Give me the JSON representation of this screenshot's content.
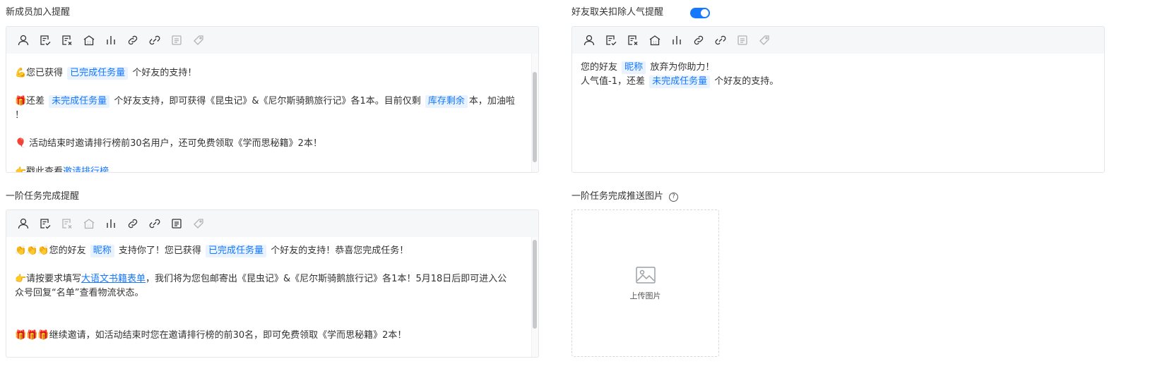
{
  "sections": {
    "new_member": {
      "title": "新成员加入提醒"
    },
    "unfollow": {
      "title": "好友取关扣除人气提醒",
      "toggle_on": true
    },
    "stage_complete": {
      "title": "一阶任务完成提醒"
    },
    "stage_image": {
      "title": "一阶任务完成推送图片",
      "help_icon": "?"
    }
  },
  "toolbar_icons": [
    "user-icon",
    "checklist-icon",
    "remove-list-icon",
    "shop-icon",
    "bar-chart-icon",
    "link-icon",
    "unlink-icon",
    "article-icon",
    "tag-icon"
  ],
  "editor1": {
    "line1": {
      "emoji": "💪",
      "pre": "您已获得",
      "tag": "已完成任务量",
      "post": "个好友的支持！"
    },
    "line2": {
      "emoji": "🎁",
      "pre": "还差",
      "tag1": "未完成任务量",
      "mid": "个好友支持，即可获得《昆虫记》&《尼尔斯骑鹅旅行记》各1本。目前仅剩",
      "tag2": "库存剩余",
      "post": "本，加油啦",
      "wrap": "！"
    },
    "line3": {
      "emoji": "🎈",
      "text": "活动结束时邀请排行榜前30名用户，还可免费领取《学而思秘籍》2本！"
    },
    "line4": {
      "emoji": "👉",
      "pre": "戳此查看",
      "link": "邀请排行榜"
    }
  },
  "editor2": {
    "line1": {
      "pre": "您的好友",
      "tag": "昵称",
      "post": "放弃为你助力！"
    },
    "line2": {
      "pre": "人气值-1，还差",
      "tag": "未完成任务量",
      "post": "个好友的支持。"
    }
  },
  "editor3": {
    "line1": {
      "emoji": "👏👏👏",
      "pre": "您的好友",
      "tag1": "昵称",
      "mid": "支持你了！您已获得",
      "tag2": "已完成任务量",
      "post": "个好友的支持！恭喜您完成任务！"
    },
    "line2": {
      "emoji": "👉",
      "pre": "请按要求填写",
      "link": "大语文书籍表单",
      "post": "，我们将为您包邮寄出《昆虫记》&《尼尔斯骑鹅旅行记》各1本！5月18日后即可进入公",
      "wrap": "众号回复“名单”查看物流状态。"
    },
    "line3": {
      "emoji": "🎁🎁🎁",
      "text": "继续邀请，如活动结束时您在邀请排行榜的前30名，即可免费领取《学而思秘籍》2本！"
    }
  },
  "upload": {
    "label": "上传图片",
    "icon": "image-icon"
  },
  "colors": {
    "accent": "#1677ff",
    "tag_bg": "#e8f3ff",
    "toolbar_bg": "#f6f7f9",
    "border": "#e4e6ea"
  }
}
